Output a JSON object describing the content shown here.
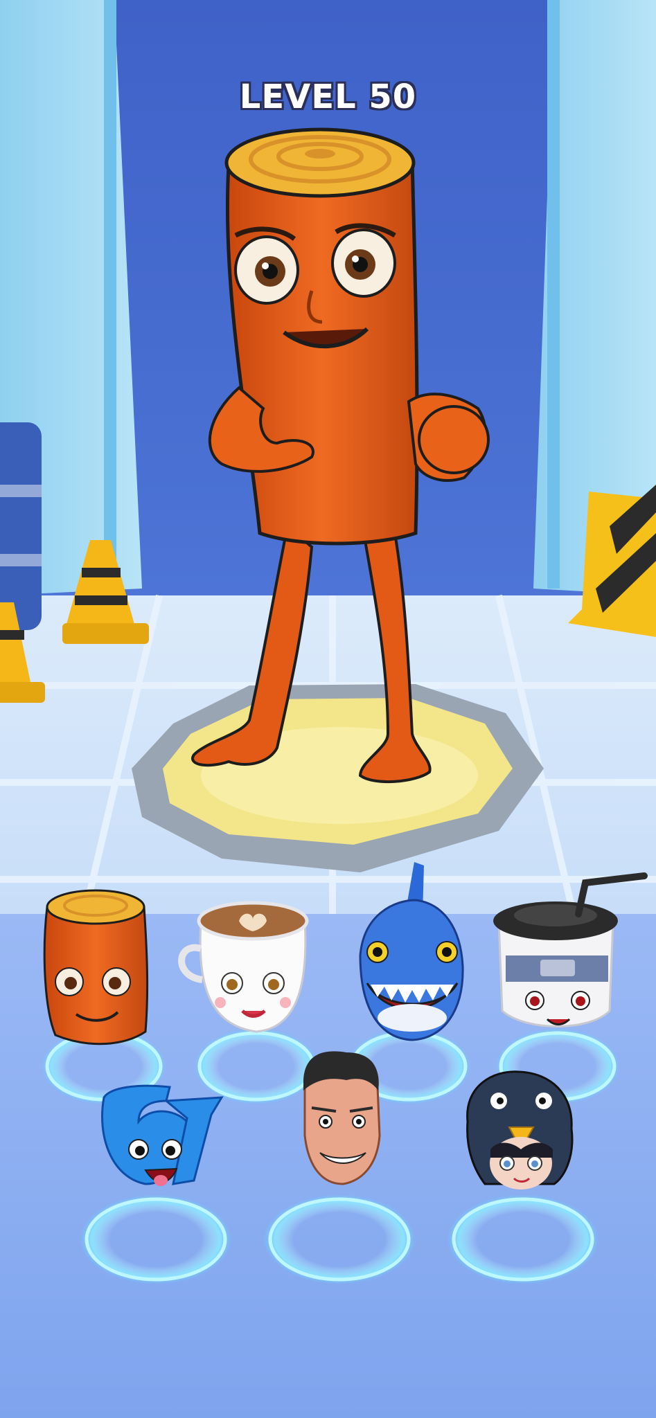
{
  "hud": {
    "level_label": "LEVEL 50"
  },
  "scene": {
    "featured_character": "log-man",
    "wall_color": "#4a6fd1",
    "floor_color": "#cfe2f9",
    "tray_color": "#8fb0f3",
    "accent_orange": "#e8621a"
  },
  "character_slots": [
    {
      "name": "log-head",
      "selected": true
    },
    {
      "name": "coffee-cup-girl",
      "selected": false
    },
    {
      "name": "shark-head",
      "selected": false
    },
    {
      "name": "ninja-cup",
      "selected": false
    },
    {
      "name": "blue-67-monster",
      "selected": false
    },
    {
      "name": "smiling-man",
      "selected": false
    },
    {
      "name": "penguin-hood-girl",
      "selected": false
    }
  ]
}
